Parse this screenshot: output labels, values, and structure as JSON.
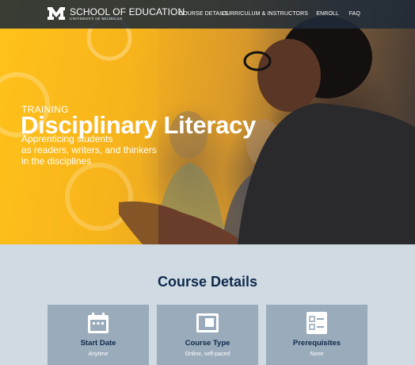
{
  "header": {
    "brand_name": "SCHOOL OF EDUCATION",
    "brand_sub": "UNIVERSITY OF MICHIGAN",
    "logo_icon": "block-m-icon",
    "nav": [
      "COURSE DETAILS",
      "CURRICULUM & INSTRUCTORS",
      "ENROLL",
      "FAQ"
    ]
  },
  "hero": {
    "eyebrow": "TRAINING",
    "title": "Disciplinary Literacy",
    "subtitle_lines": [
      "Apprenticing students",
      "as readers, writers, and thinkers",
      "in the disciplines"
    ]
  },
  "details": {
    "title": "Course Details",
    "cards": [
      {
        "icon": "calendar-icon",
        "title": "Start Date",
        "value": "Anytime"
      },
      {
        "icon": "window-icon",
        "title": "Course Type",
        "value": "Online, self-paced"
      },
      {
        "icon": "checklist-icon",
        "title": "Prerequisites",
        "value": "None"
      }
    ]
  },
  "colors": {
    "header_bg": "#1e2a38",
    "hero_accent": "#ffc21a",
    "heading": "#0f2a4b",
    "card_bg": "#9aabbb",
    "page_bg": "#cfdae3"
  }
}
